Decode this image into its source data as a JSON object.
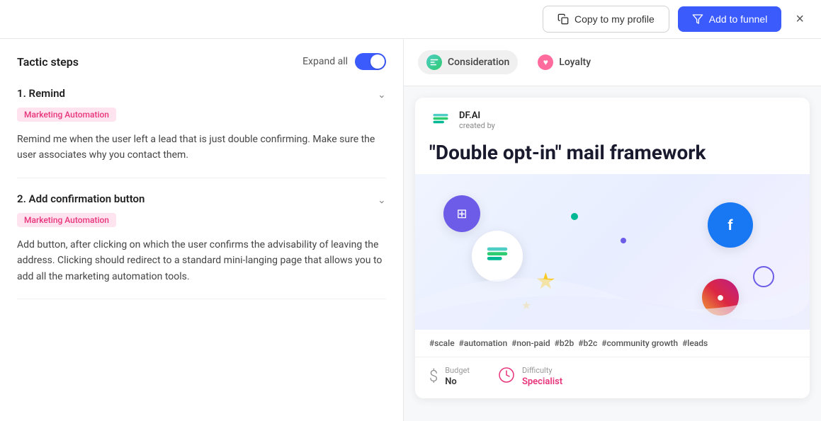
{
  "header": {
    "copy_btn_label": "Copy to my profile",
    "add_funnel_btn_label": "Add to funnel",
    "close_icon": "×"
  },
  "left_panel": {
    "tactic_steps_title": "Tactic steps",
    "expand_all_label": "Expand all",
    "steps": [
      {
        "number": "1",
        "title": "Remind",
        "tag": "Marketing Automation",
        "description": "Remind me when the user left a lead that is just double confirming. Make sure the user associates why you contact them."
      },
      {
        "number": "2",
        "title": "Add confirmation button",
        "tag": "Marketing Automation",
        "description": "Add button, after clicking on which the user confirms the advisability of leaving the address. Clicking should redirect to a standard mini-langing page that allows you to add all the marketing automation tools."
      }
    ]
  },
  "right_panel": {
    "tabs": [
      {
        "id": "consideration",
        "label": "Consideration",
        "icon_type": "consideration"
      },
      {
        "id": "loyalty",
        "label": "Loyalty",
        "icon_type": "loyalty"
      }
    ],
    "card": {
      "creator_name": "DF.AI",
      "creator_label": "created by",
      "title": "\"Double opt-in\" mail framework",
      "tags": [
        "#scale",
        "#automation",
        "#non-paid",
        "#b2b",
        "#b2c",
        "#community growth",
        "#leads"
      ],
      "budget_label": "Budget",
      "budget_value": "No",
      "difficulty_label": "Difficulty",
      "difficulty_value": "Specialist"
    }
  }
}
